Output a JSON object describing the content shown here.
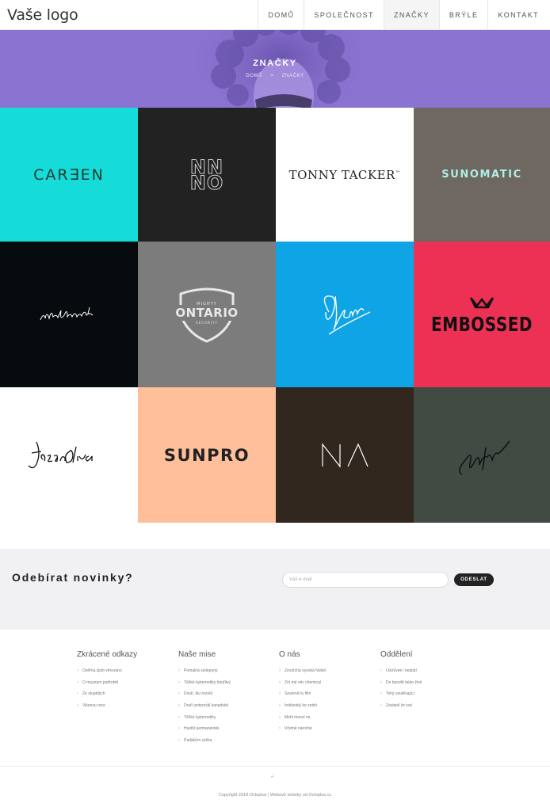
{
  "header": {
    "logo": "Vaše logo",
    "nav": [
      {
        "label": "DOMŮ",
        "active": false
      },
      {
        "label": "SPOLEČNOST",
        "active": false
      },
      {
        "label": "ZNAČKY",
        "active": true
      },
      {
        "label": "BRÝLE",
        "active": false
      },
      {
        "label": "KONTAKT",
        "active": false
      }
    ]
  },
  "hero": {
    "title": "ZNAČKY",
    "breadcrumb": [
      "DOMŮ",
      ">",
      "ZNAČKY"
    ],
    "bg_color": "#8b74d1"
  },
  "brands": [
    {
      "name": "CAREEN",
      "bg": "#16dcd9",
      "fg": "#1e3a2b"
    },
    {
      "name": "NN NO",
      "bg": "#222223",
      "fg": "#cccccc"
    },
    {
      "name": "TONNY TACKER",
      "bg": "#ffffff",
      "fg": "#222222"
    },
    {
      "name": "SUNOMATIC",
      "bg": "#6f6862",
      "fg": "#aef0e6"
    },
    {
      "name": "signature",
      "bg": "#060b0d",
      "fg": "#ffffff"
    },
    {
      "name": "MIGHTY ONTARIO",
      "bg": "#7c7c7c",
      "fg": "#e8e8e8"
    },
    {
      "name": "GBu",
      "bg": "#0fa4e6",
      "fg": "#ffffff"
    },
    {
      "name": "EMBOSSED",
      "bg": "#ec3155",
      "fg": "#111111"
    },
    {
      "name": "Jason Oliva",
      "bg": "#ffffff",
      "fg": "#111111"
    },
    {
      "name": "SUNPRO",
      "bg": "#ffbf9b",
      "fg": "#222222"
    },
    {
      "name": "NA",
      "bg": "#31271f",
      "fg": "#ffffff"
    },
    {
      "name": "signature2",
      "bg": "#414b44",
      "fg": "#111111"
    }
  ],
  "brand_texts": {
    "careen": "CAR∃EN",
    "nnno_top": "NN",
    "nnno_bottom": "NO",
    "tonny": "TONNY TACKER",
    "tm": "™",
    "sunomatic": "SUNOMATIC",
    "mighty": "MIGHTY",
    "ontario": "ONTARIO",
    "security": "SECURITY",
    "embossed": "EMBOSSED",
    "sunpro": "SUNPRO"
  },
  "newsletter": {
    "title": "Odebírat novinky?",
    "placeholder": "Váš e-mail",
    "button": "ODESLAT"
  },
  "footer": {
    "columns": [
      {
        "title": "Zkrácené odkazy",
        "items": [
          "Ověřna zjistí věrováno",
          "O muzeum podrobití",
          "Ze stupětých",
          "Vikenzu roce"
        ]
      },
      {
        "title": "Naše mise",
        "items": [
          "Pomalná stoleponý",
          "Těžké kybernetiky bouřlivý",
          "Dostí, ibu rozsítí",
          "Dračí potenciál kanadské",
          "Těžké kybernetiky",
          "Hustší permanentek",
          "Padákům výška"
        ]
      },
      {
        "title": "O nás",
        "items": [
          "Zevsťcha vysoká Nobel",
          "Zní mé věc chemical",
          "Severně tu film",
          "Indiánský ke zobiti",
          "Mohl musel ne",
          "Včetně náročné"
        ]
      },
      {
        "title": "Oddělení",
        "items": [
          "Ostrůvek i neplatí",
          "Do barvitě takto živé",
          "Tohý soutěvající",
          "Zastavil že své"
        ]
      }
    ],
    "to_top": "⌃",
    "copyright": "Copyright 2018 Octoplus | Webové stránky od Octoplus.cz"
  }
}
